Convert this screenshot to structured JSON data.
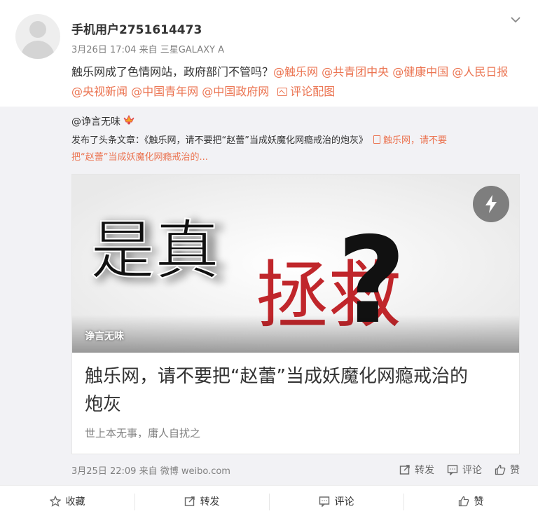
{
  "post": {
    "username": "手机用户2751614473",
    "time": "3月26日 17:04",
    "source_prefix": "来自",
    "device": "三星GALAXY A",
    "text_line1_plain": "触乐网成了色情网站，政府部门不管吗？",
    "mentions": [
      "@触乐网",
      "@共青团中央",
      "@健康中国",
      "@人民日报",
      "@央视新闻",
      "@中国青年网",
      "@中国政府网"
    ],
    "mention_lead": "@",
    "pic_link": "评论配图",
    "menu_icon": "chevron-down-icon"
  },
  "repost": {
    "user": "@诤言无味",
    "badge_icon": "vip-crown-icon",
    "text_prefix": "发布了头条文章：《触乐网，请不要把“赵蕾”当成妖魔化网瘾戒治的炮灰》",
    "link_text_1": "触乐网，请不要",
    "link_text_2": "把“赵蕾”当成妖魔化网瘾戒治的...",
    "card": {
      "image_text_left": "是真",
      "image_text_right": "拯救",
      "image_qmark": "?",
      "image_badge": "诤言无味",
      "flash_icon": "lightning-icon",
      "title_line1": "触乐网，请不要把“赵蕾”当成妖魔化网瘾戒治的",
      "title_line2": "炮灰",
      "subtitle": "世上本无事，庸人自扰之"
    },
    "footer": {
      "time": "3月25日 22:09",
      "source_prefix": "来自",
      "source": "微博 weibo.com",
      "repost_label": "转发",
      "comment_label": "评论",
      "like_label": "赞"
    }
  },
  "bottom_bar": {
    "favorite": "收藏",
    "repost": "转发",
    "comment": "评论",
    "like": "赞"
  },
  "colors": {
    "link": "#eb7350",
    "repost_bg": "#f2f2f5",
    "meta_gray": "#808080"
  }
}
